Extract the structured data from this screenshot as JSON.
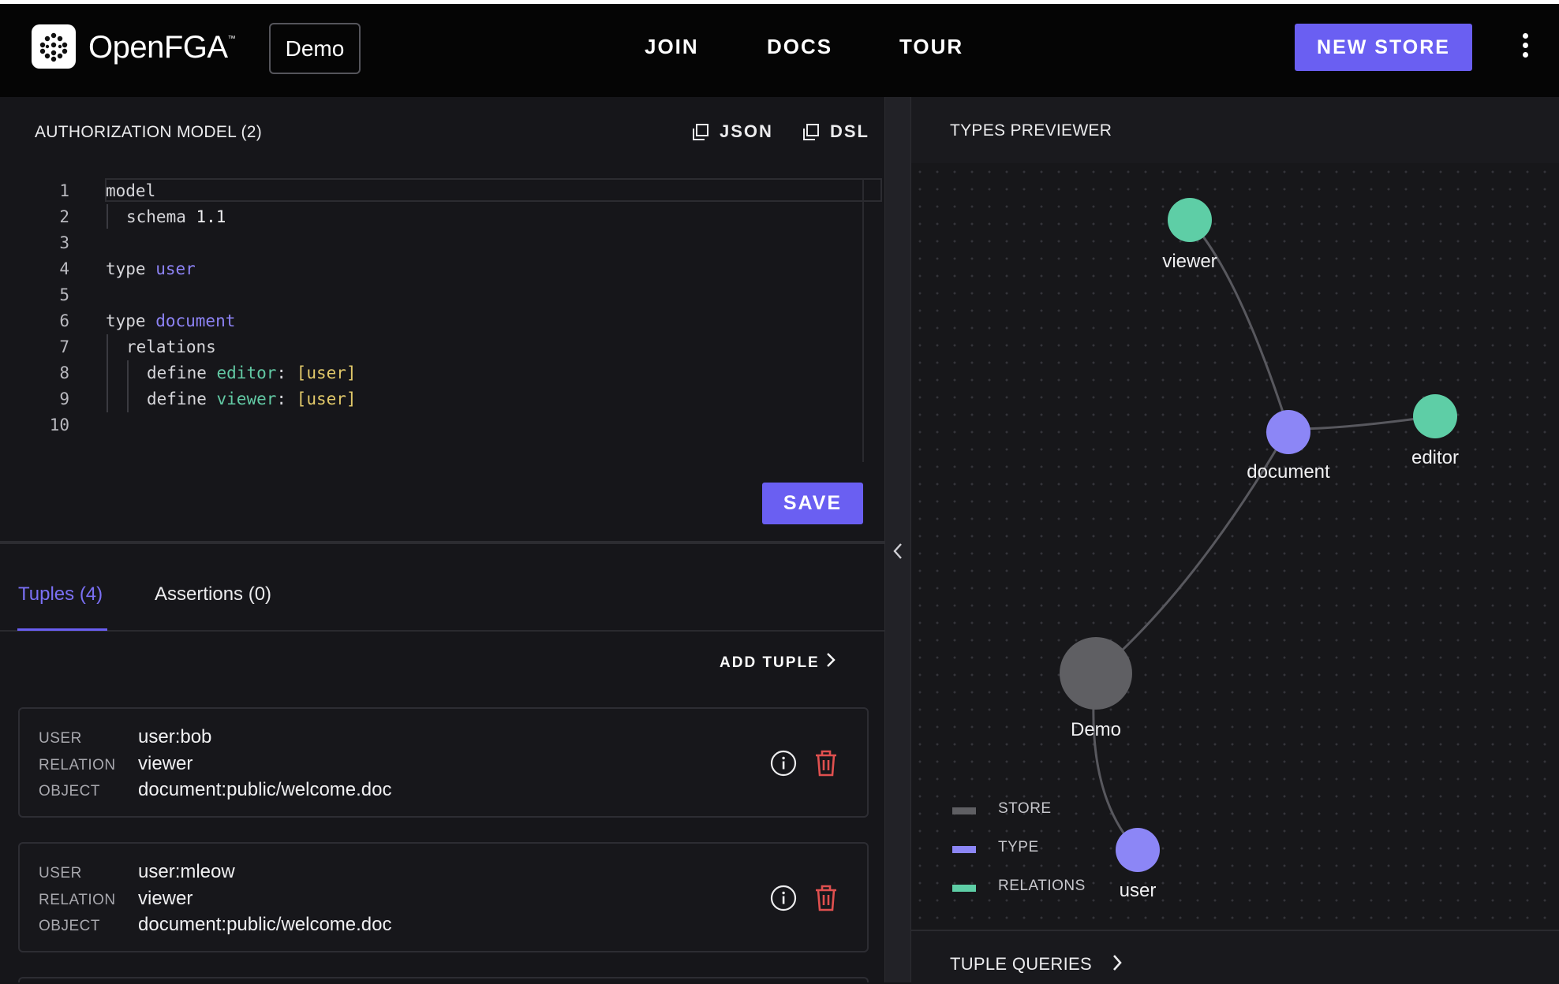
{
  "header": {
    "logo_text": "OpenFGA",
    "logo_tm": "™",
    "store_name": "Demo",
    "nav": [
      "JOIN",
      "DOCS",
      "TOUR"
    ],
    "new_store_label": "NEW STORE"
  },
  "model_panel": {
    "title": "AUTHORIZATION MODEL (2)",
    "json_label": "JSON",
    "dsl_label": "DSL",
    "save_label": "SAVE",
    "line_numbers": [
      "1",
      "2",
      "3",
      "4",
      "5",
      "6",
      "7",
      "8",
      "9",
      "10"
    ],
    "code": {
      "l1": "model",
      "l2_kw": "schema",
      "l2_val": " 1.1",
      "l4_kw": "type ",
      "l4_name": "user",
      "l6_kw": "type ",
      "l6_name": "document",
      "l7": "relations",
      "l8_kw": "define ",
      "l8_rel": "editor",
      "l8_colon": ": ",
      "l8_val": "[user]",
      "l9_kw": "define ",
      "l9_rel": "viewer",
      "l9_colon": ": ",
      "l9_val": "[user]"
    }
  },
  "tabs": {
    "tuples": "Tuples (4)",
    "assertions": "Assertions (0)",
    "add_tuple": "ADD TUPLE"
  },
  "tuples": [
    {
      "user_key": "USER",
      "user": "user:bob",
      "relation_key": "RELATION",
      "relation": "viewer",
      "object_key": "OBJECT",
      "object": "document:public/welcome.doc"
    },
    {
      "user_key": "USER",
      "user": "user:mleow",
      "relation_key": "RELATION",
      "relation": "viewer",
      "object_key": "OBJECT",
      "object": "document:public/welcome.doc"
    }
  ],
  "previewer": {
    "title": "TYPES PREVIEWER",
    "nodes": {
      "viewer": "viewer",
      "document": "document",
      "editor": "editor",
      "demo": "Demo",
      "user": "user"
    },
    "legend": {
      "store": "STORE",
      "type": "TYPE",
      "relations": "RELATIONS"
    },
    "colors": {
      "store": "#5f5f63",
      "type": "#8c86f6",
      "relations": "#5ecea6",
      "edge": "#58585e"
    }
  },
  "tuple_queries": {
    "label": "TUPLE QUERIES"
  }
}
